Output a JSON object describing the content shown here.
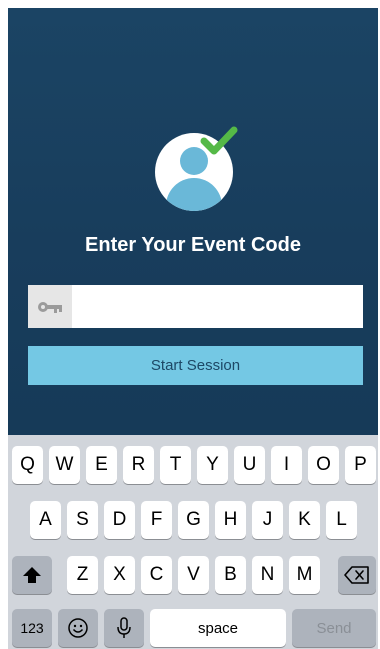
{
  "app": {
    "title": "Enter Your Event Code",
    "code_input_value": "",
    "code_input_placeholder": "",
    "start_button_label": "Start Session",
    "colors": {
      "background": "#1b4464",
      "button": "#74c8e4",
      "avatar": "#6ab8d8",
      "check": "#55b947"
    },
    "icons": [
      "user-avatar-icon",
      "check-icon",
      "key-icon"
    ]
  },
  "keyboard": {
    "row1": [
      "Q",
      "W",
      "E",
      "R",
      "T",
      "Y",
      "U",
      "I",
      "O",
      "P"
    ],
    "row2": [
      "A",
      "S",
      "D",
      "F",
      "G",
      "H",
      "J",
      "K",
      "L"
    ],
    "row3": [
      "Z",
      "X",
      "C",
      "V",
      "B",
      "N",
      "M"
    ],
    "numbers_label": "123",
    "space_label": "space",
    "send_label": "Send",
    "icons": [
      "shift-icon",
      "backspace-icon",
      "emoji-icon",
      "microphone-icon"
    ]
  }
}
